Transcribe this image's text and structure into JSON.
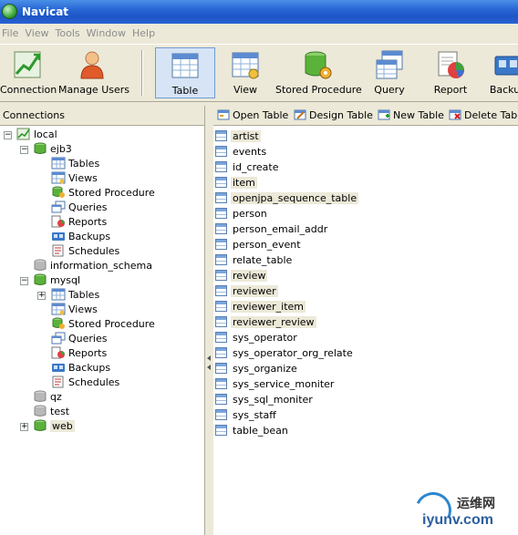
{
  "window": {
    "title": "Navicat"
  },
  "menu": [
    "File",
    "View",
    "Tools",
    "Window",
    "Help"
  ],
  "toolbar": {
    "buttons": [
      {
        "label": "Connection",
        "icon": "connection-icon"
      },
      {
        "label": "Manage Users",
        "icon": "manage-users-icon"
      },
      {
        "label": "Table",
        "icon": "table-icon",
        "active": true
      },
      {
        "label": "View",
        "icon": "view-icon"
      },
      {
        "label": "Stored Procedure",
        "icon": "stored-procedure-icon"
      },
      {
        "label": "Query",
        "icon": "query-icon"
      },
      {
        "label": "Report",
        "icon": "report-icon"
      },
      {
        "label": "Backup",
        "icon": "backup-icon"
      }
    ]
  },
  "connections": {
    "header": "Connections",
    "root": "local",
    "databases": {
      "ejb3": "ejb3",
      "information_schema": "information_schema",
      "mysql": "mysql",
      "qz": "qz",
      "test": "test",
      "web": "web"
    },
    "children": [
      "Tables",
      "Views",
      "Stored Procedure",
      "Queries",
      "Reports",
      "Backups",
      "Schedules"
    ]
  },
  "object_toolbar": {
    "open": "Open Table",
    "design": "Design Table",
    "new": "New Table",
    "delete": "Delete Table"
  },
  "tables": [
    "artist",
    "events",
    "id_create",
    "item",
    "openjpa_sequence_table",
    "person",
    "person_email_addr",
    "person_event",
    "relate_table",
    "review",
    "reviewer",
    "reviewer_item",
    "reviewer_review",
    "sys_operator",
    "sys_operator_org_relate",
    "sys_organize",
    "sys_service_moniter",
    "sys_sql_moniter",
    "sys_staff",
    "table_bean"
  ],
  "watermark": {
    "cn": "运维网",
    "en": "iyunv.com"
  },
  "colors": {
    "titlebar": "#2766d4",
    "selected": "#d6e4f5",
    "db_green": "#3aa63a"
  }
}
